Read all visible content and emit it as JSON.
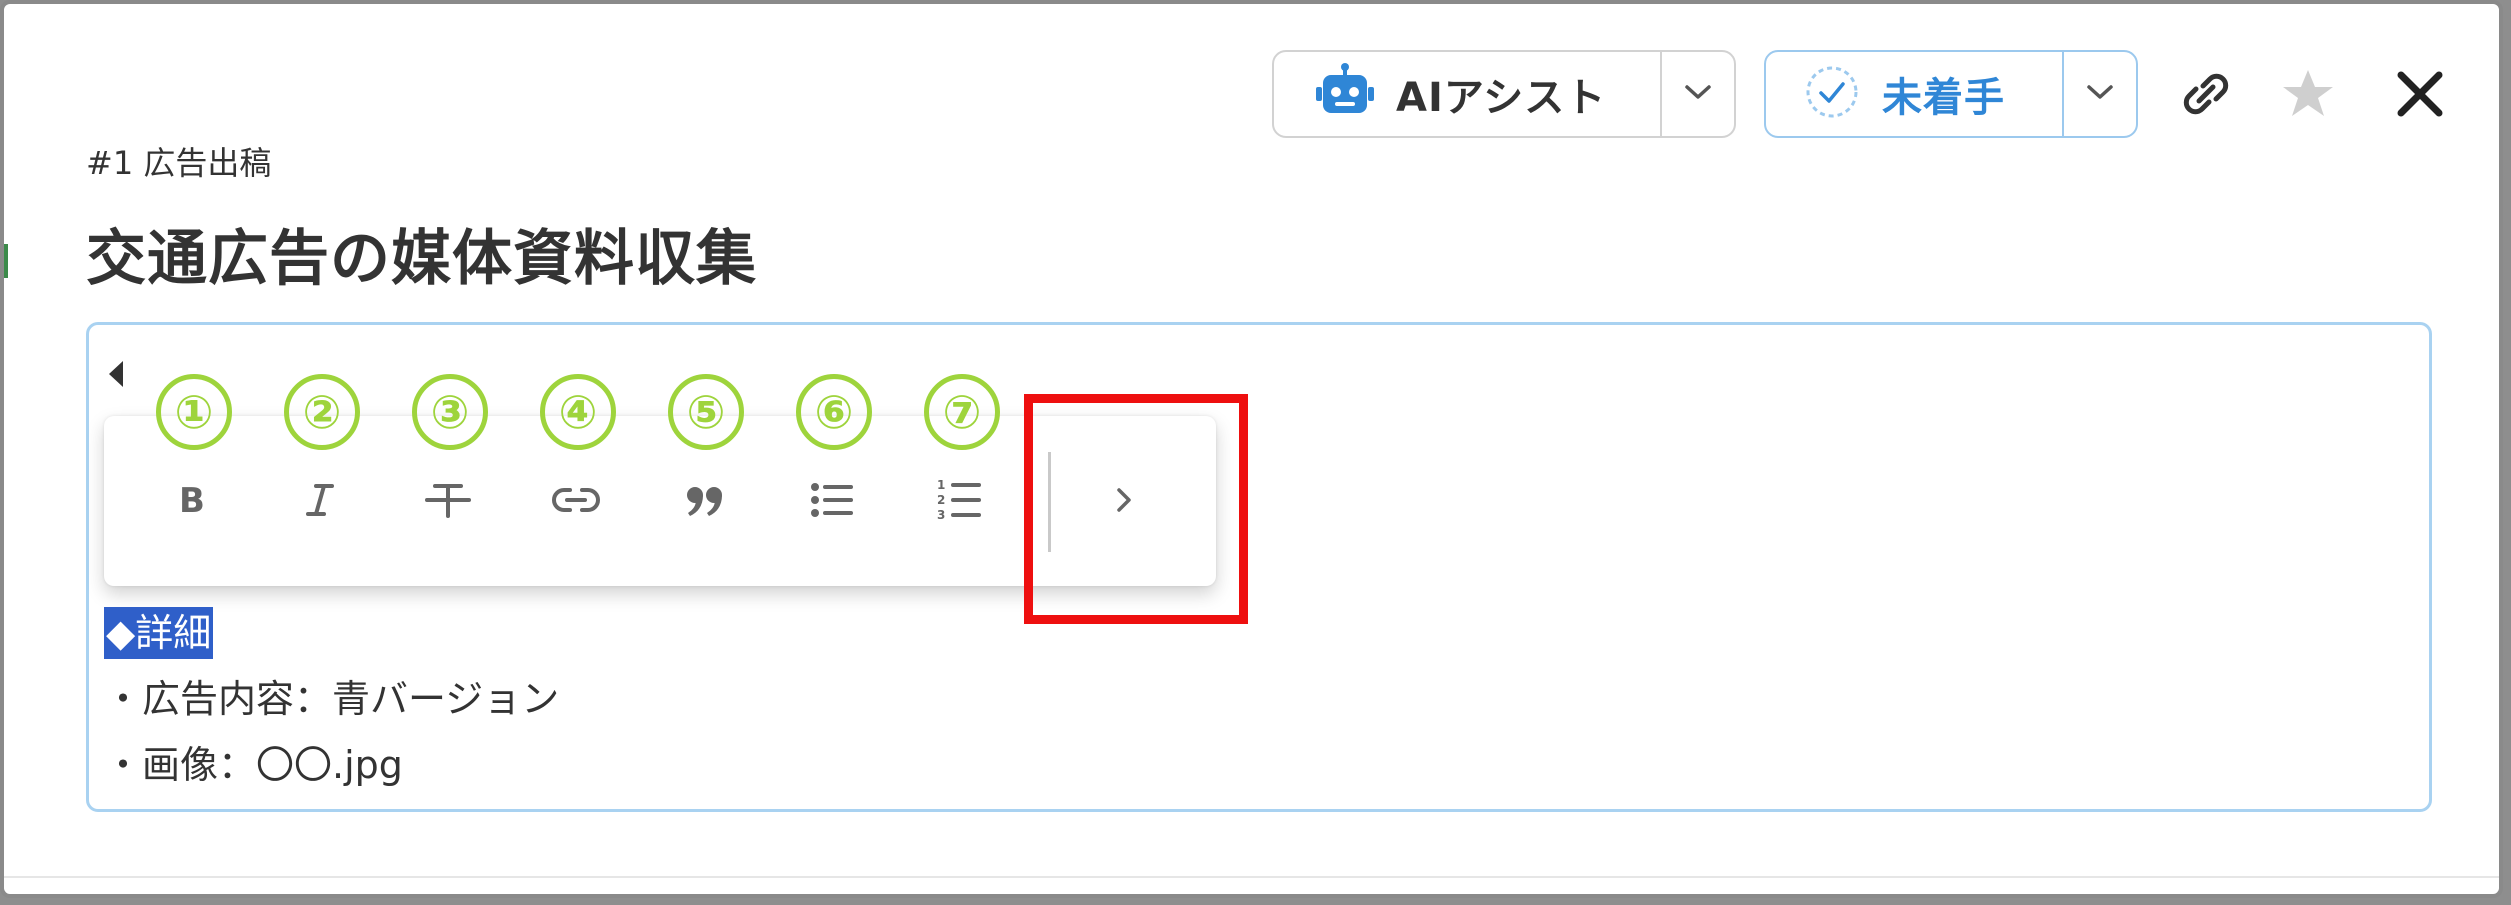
{
  "header": {
    "ai_assist_label": "AIアシスト",
    "status_label": "未着手"
  },
  "task": {
    "breadcrumb": "#1 広告出稿",
    "title": "交通広告の媒体資料収集"
  },
  "annotations": {
    "numbers": [
      "①",
      "②",
      "③",
      "④",
      "⑤",
      "⑥",
      "⑦"
    ]
  },
  "editor": {
    "selected_text": "◆詳細",
    "lines": [
      "・広告内容：青バージョン",
      "・画像：〇〇.jpg"
    ]
  },
  "colors": {
    "accent": "#2f86d6",
    "annotation_green": "#9ed43c",
    "highlight_red": "#ee0f0f",
    "selection_blue": "#2f5fc9"
  }
}
